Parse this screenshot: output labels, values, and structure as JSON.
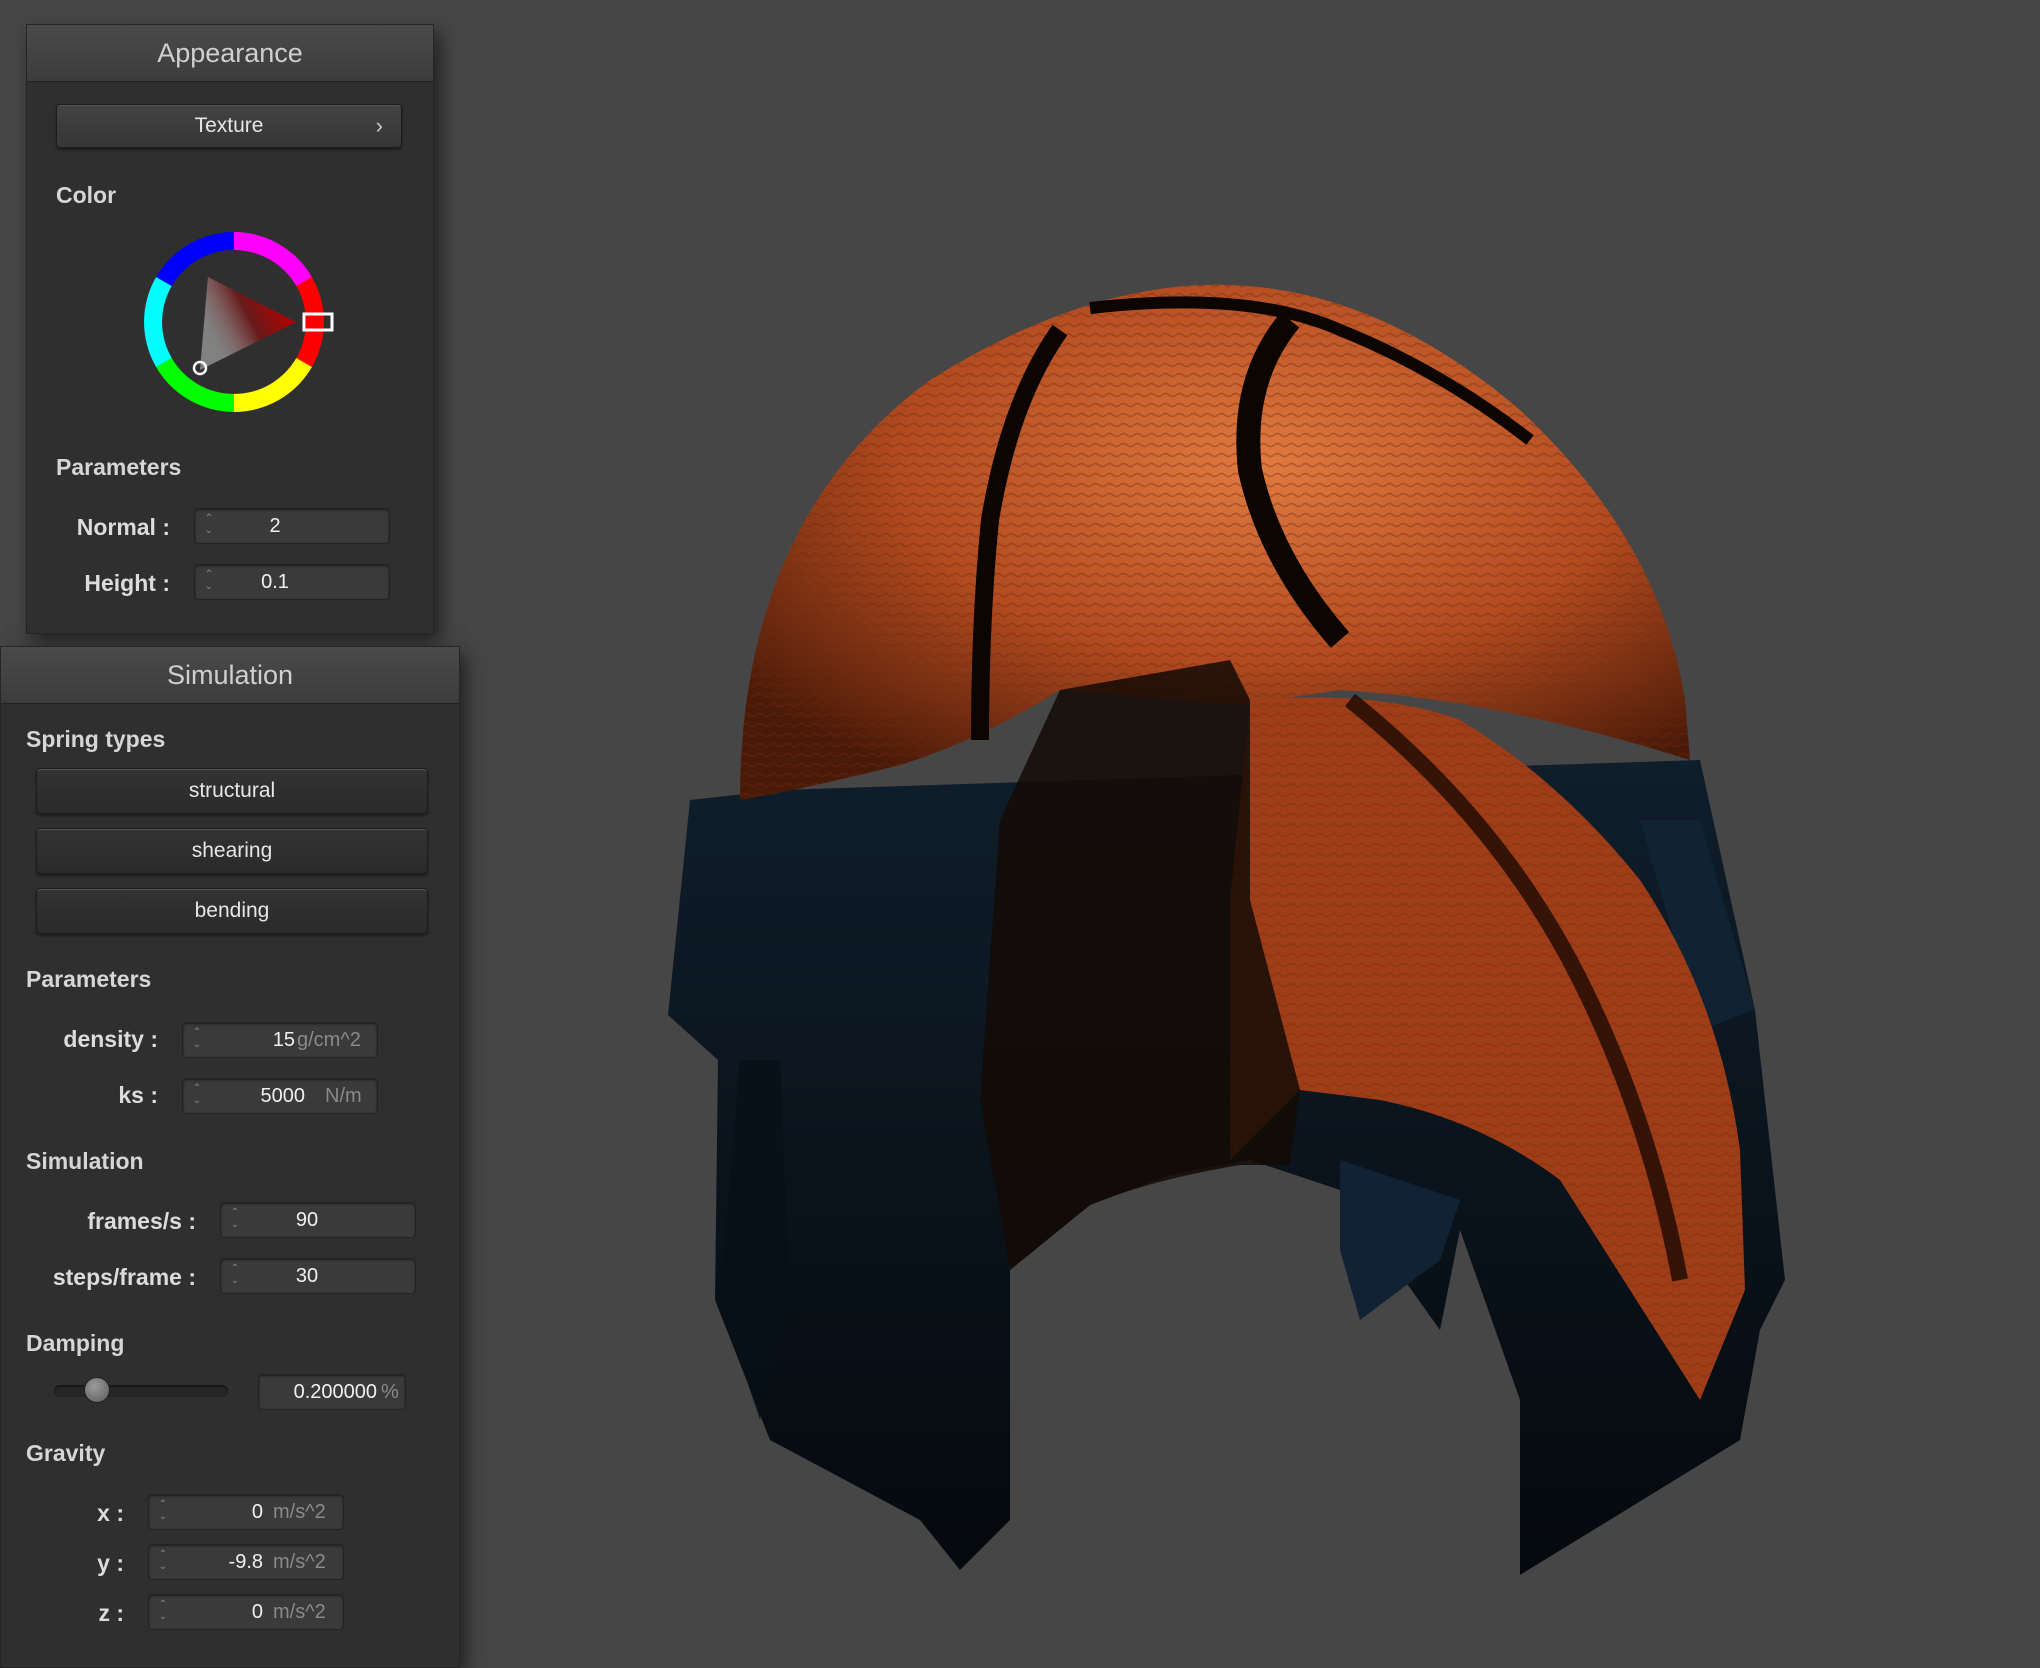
{
  "appearance": {
    "title": "Appearance",
    "texture_button": "Texture",
    "color_label": "Color",
    "selected_color": "#ff0000",
    "parameters_label": "Parameters",
    "normal": {
      "label": "Normal :",
      "value": "2"
    },
    "height": {
      "label": "Height :",
      "value": "0.1"
    }
  },
  "simulation": {
    "title": "Simulation",
    "spring_types_label": "Spring types",
    "spring_types": [
      "structural",
      "shearing",
      "bending"
    ],
    "parameters_label": "Parameters",
    "density": {
      "label": "density :",
      "value": "15",
      "unit": "g/cm^2"
    },
    "ks": {
      "label": "ks :",
      "value": "5000",
      "unit": "N/m"
    },
    "simulation_label": "Simulation",
    "frames": {
      "label": "frames/s :",
      "value": "90"
    },
    "steps": {
      "label": "steps/frame :",
      "value": "30"
    },
    "damping_label": "Damping",
    "damping": {
      "value": "0.200000",
      "unit": "%",
      "slider_fraction": 0.2
    },
    "gravity_label": "Gravity",
    "gravity": [
      {
        "label": "x :",
        "value": "0",
        "unit": "m/s^2"
      },
      {
        "label": "y :",
        "value": "-9.8",
        "unit": "m/s^2"
      },
      {
        "label": "z :",
        "value": "0",
        "unit": "m/s^2"
      }
    ]
  },
  "viewport": {
    "content": "cloth-draped-over-sphere",
    "texture": "basketball",
    "colors": {
      "background": "#464646",
      "orange": "#c85a2a",
      "dark": "#0d1a24"
    }
  }
}
